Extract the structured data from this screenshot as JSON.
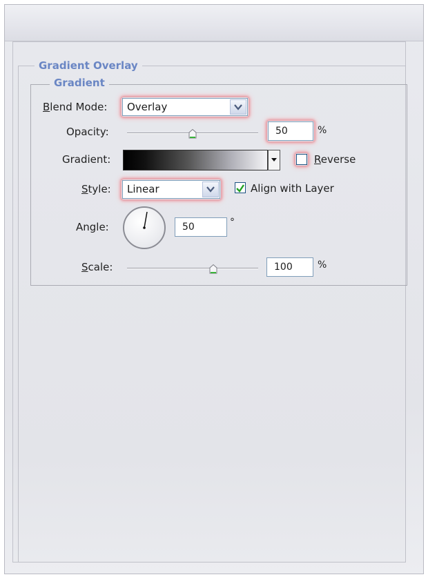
{
  "panel": {
    "section_title": "Gradient Overlay",
    "group_title": "Gradient"
  },
  "blend_mode": {
    "label": "Blend Mode:",
    "label_first": "B",
    "label_rest": "lend Mode:",
    "value": "Overlay"
  },
  "opacity": {
    "label": "Opacity:",
    "value": "50",
    "unit": "%",
    "level": 0.5
  },
  "gradient": {
    "label": "Gradient:",
    "reverse_label": "Reverse",
    "reverse_first": "R",
    "reverse_rest": "everse",
    "reverse_checked": false
  },
  "style": {
    "label_first": "S",
    "label_rest": "tyle:",
    "value": "Linear",
    "align_label": "Align with Layer",
    "align_checked": true
  },
  "angle": {
    "label": "Angle:",
    "value": "50",
    "unit": "°"
  },
  "scale": {
    "label_first": "S",
    "label_rest": "cale:",
    "value": "100",
    "unit": "%",
    "level": 0.66
  },
  "colors": {
    "accent": "#6a86c4",
    "glow": "#e59aa3",
    "check": "#21a121"
  },
  "icons": {
    "dropdown": "chevron-down-icon",
    "check": "checkmark-icon",
    "slider": "slider-thumb-icon"
  }
}
